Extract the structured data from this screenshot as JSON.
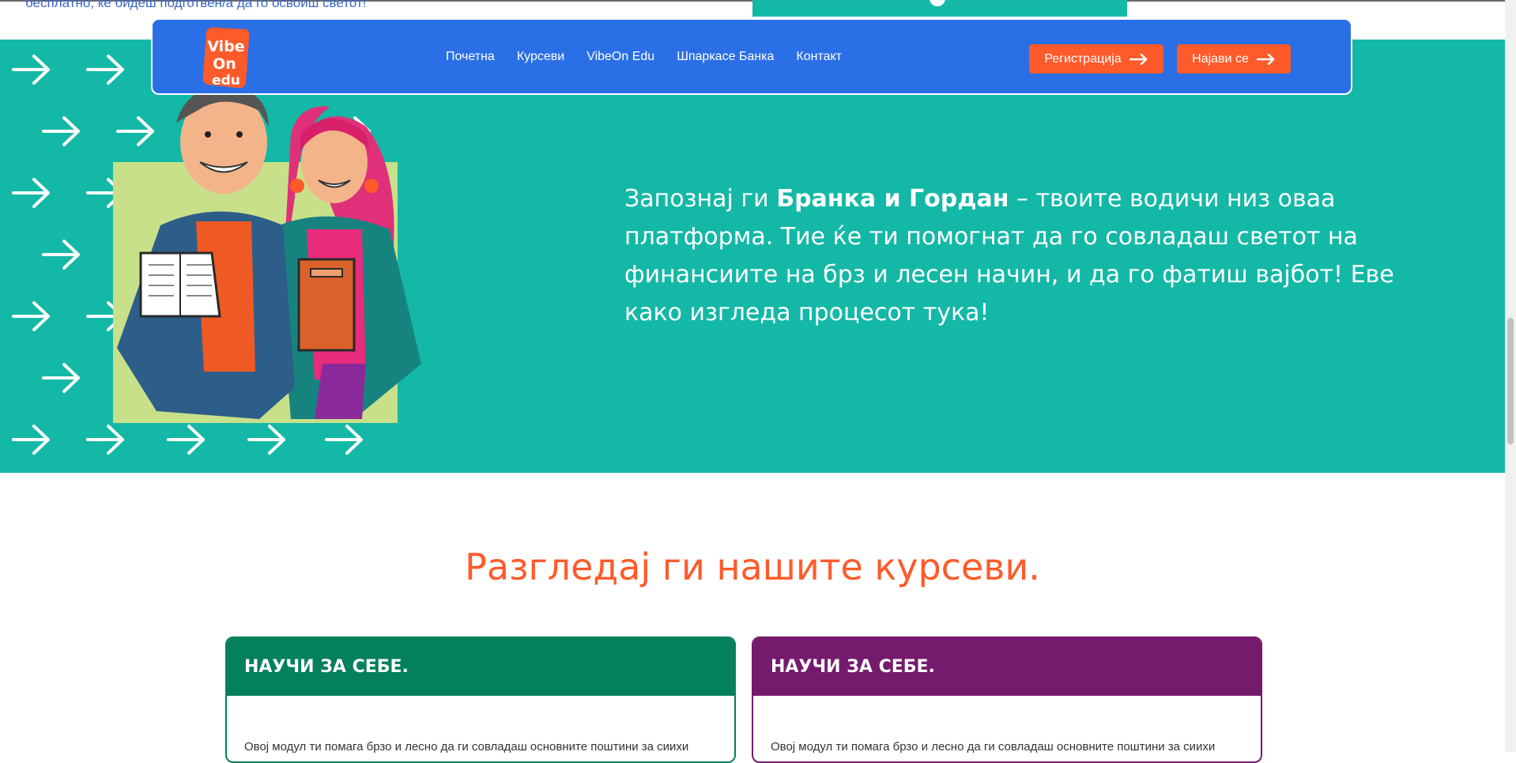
{
  "top": {
    "text": "бесплатно, ќе бидеш подготвен/а да го освоиш светот!"
  },
  "navbar": {
    "logo": {
      "line1": "Vibe",
      "line2": "On",
      "line3": "edu"
    },
    "links": [
      "Почетна",
      "Курсеви",
      "VibeOn Edu",
      "Шпаркасе Банка",
      "Контакт"
    ],
    "register_label": "Регистрација",
    "login_label": "Најави се"
  },
  "hero": {
    "text_before": "Запознај ги ",
    "text_bold": "Бранка и Гордан",
    "text_after": " – твоите водичи низ оваа платформа. Тие ќе ти помогнат да го совладаш светот на финансиите на брз и лесен начин, и да го фатиш вајбот! Еве како изгледа процесот тука!"
  },
  "courses": {
    "title": "Разгледај ги нашите курсеви.",
    "cards": [
      {
        "heading": "НАУЧИ ЗА СЕБЕ.",
        "body": "Овој модул ти помага брзо и лесно да ги совладаш основните поштини за сиихи"
      },
      {
        "heading": "НАУЧИ ЗА СЕБЕ.",
        "body": "Овој модул ти помага брзо и лесно да ги совладаш основните поштини за сиихи"
      }
    ]
  },
  "colors": {
    "hero_bg": "#14b8a6",
    "navbar_bg": "#2a6fe6",
    "accent": "#ff5a2a",
    "card_green": "#05805c",
    "card_purple": "#741b6d"
  },
  "icons": [
    "arrow-right-icon",
    "logo-icon"
  ]
}
